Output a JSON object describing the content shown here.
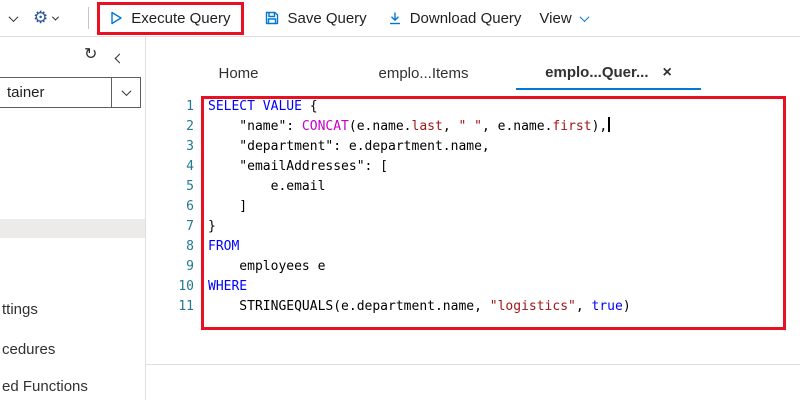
{
  "toolbar": {
    "execute_label": "Execute Query",
    "save_label": "Save Query",
    "download_label": "Download Query",
    "view_label": "View"
  },
  "sidebar": {
    "container_select_value": "tainer",
    "items": [
      {
        "label": "ttings"
      },
      {
        "label": "cedures"
      },
      {
        "label": "ed Functions"
      }
    ]
  },
  "tabs": [
    {
      "label": "Home",
      "active": false,
      "closable": false
    },
    {
      "label": "emplo...Items",
      "active": false,
      "closable": false
    },
    {
      "label": "emplo...Quer...",
      "active": true,
      "closable": true
    }
  ],
  "icons": {
    "close": "×",
    "gear": "⚙",
    "refresh": "↻"
  },
  "editor": {
    "language": "SQL",
    "lines": [
      {
        "n": "1",
        "tokens": [
          {
            "c": "kw",
            "t": "SELECT VALUE"
          },
          {
            "c": "pl",
            "t": " {"
          }
        ]
      },
      {
        "n": "2",
        "tokens": [
          {
            "c": "pl",
            "t": "    \"name\": "
          },
          {
            "c": "fn",
            "t": "CONCAT"
          },
          {
            "c": "pl",
            "t": "(e.name."
          },
          {
            "c": "str",
            "t": "last"
          },
          {
            "c": "pl",
            "t": ", "
          },
          {
            "c": "str",
            "t": "\" \""
          },
          {
            "c": "pl",
            "t": ", e.name."
          },
          {
            "c": "str",
            "t": "first"
          },
          {
            "c": "pl",
            "t": "),"
          },
          {
            "c": "caret",
            "t": ""
          }
        ]
      },
      {
        "n": "3",
        "tokens": [
          {
            "c": "pl",
            "t": "    \"department\": e.department.name,"
          }
        ]
      },
      {
        "n": "4",
        "tokens": [
          {
            "c": "pl",
            "t": "    \"emailAddresses\": ["
          }
        ]
      },
      {
        "n": "5",
        "tokens": [
          {
            "c": "pl",
            "t": "        e.email"
          }
        ]
      },
      {
        "n": "6",
        "tokens": [
          {
            "c": "pl",
            "t": "    ]"
          }
        ]
      },
      {
        "n": "7",
        "tokens": [
          {
            "c": "pl",
            "t": "}"
          }
        ]
      },
      {
        "n": "8",
        "tokens": [
          {
            "c": "kw",
            "t": "FROM"
          }
        ]
      },
      {
        "n": "9",
        "tokens": [
          {
            "c": "pl",
            "t": "    employees e"
          }
        ]
      },
      {
        "n": "10",
        "tokens": [
          {
            "c": "kw",
            "t": "WHERE"
          }
        ]
      },
      {
        "n": "11",
        "tokens": [
          {
            "c": "pl",
            "t": "    STRINGEQUALS(e.department.name, "
          },
          {
            "c": "str",
            "t": "\"logistics\""
          },
          {
            "c": "pl",
            "t": ", "
          },
          {
            "c": "kw",
            "t": "true"
          },
          {
            "c": "pl",
            "t": ")"
          }
        ]
      }
    ]
  },
  "colors": {
    "accent": "#0078d4",
    "annotation_red": "#e81123",
    "keyword": "#0000ff",
    "string": "#a31515",
    "builtin_function": "#c800c8",
    "line_number": "#237893",
    "text": "#323130"
  }
}
